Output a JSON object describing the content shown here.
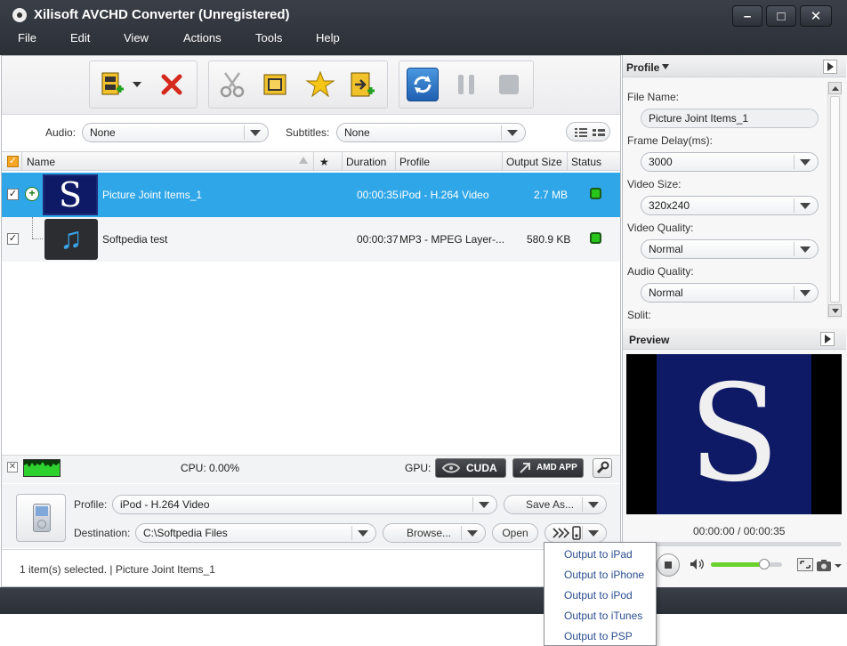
{
  "window": {
    "title": "Xilisoft AVCHD Converter (Unregistered)",
    "controls": {
      "minimize": "–",
      "maximize": "□",
      "close": "✕"
    }
  },
  "menu": [
    "File",
    "Edit",
    "View",
    "Actions",
    "Tools",
    "Help"
  ],
  "toolbar": {
    "icons": [
      "add-file-icon",
      "remove-icon",
      "clip-icon",
      "merge-icon",
      "effects-icon",
      "add-output-icon",
      "convert-icon",
      "pause-icon",
      "stop-icon"
    ]
  },
  "filters": {
    "audio_label": "Audio:",
    "audio_value": "None",
    "subtitles_label": "Subtitles:",
    "subtitles_value": "None"
  },
  "list": {
    "columns": {
      "name": "Name",
      "star": "★",
      "duration": "Duration",
      "profile": "Profile",
      "output_size": "Output Size",
      "status": "Status"
    },
    "rows": [
      {
        "name": "Picture Joint Items_1",
        "duration": "00:00:35",
        "profile": "iPod - H.264 Video",
        "output_size": "2.7 MB",
        "thumb_letter": "S",
        "selected": true
      },
      {
        "name": "Softpedia test",
        "duration": "00:00:37",
        "profile": "MP3 - MPEG Layer-...",
        "output_size": "580.9 KB",
        "thumb_letter": "♫",
        "selected": false
      }
    ]
  },
  "cpu": {
    "label": "CPU: 0.00%",
    "gpu_label": "GPU:",
    "cuda": "CUDA",
    "amd": "AMD APP"
  },
  "output": {
    "profile_label": "Profile:",
    "profile_value": "iPod - H.264 Video",
    "save_as": "Save As...",
    "destination_label": "Destination:",
    "destination_value": "C:\\Softpedia Files",
    "browse": "Browse...",
    "open": "Open"
  },
  "status_bar": {
    "text": "1 item(s) selected. | Picture Joint Items_1"
  },
  "profile_panel": {
    "header": "Profile",
    "file_name_label": "File Name:",
    "file_name_value": "Picture Joint Items_1",
    "frame_delay_label": "Frame Delay(ms):",
    "frame_delay_value": "3000",
    "video_size_label": "Video Size:",
    "video_size_value": "320x240",
    "video_quality_label": "Video Quality:",
    "video_quality_value": "Normal",
    "audio_quality_label": "Audio Quality:",
    "audio_quality_value": "Normal",
    "split_label": "Split:"
  },
  "preview": {
    "header": "Preview",
    "letter": "S",
    "time": "00:00:00 / 00:00:35",
    "volume_level": 0.75
  },
  "popup_menu": [
    "Output to iPad",
    "Output to iPhone",
    "Output to iPod",
    "Output to iTunes",
    "Output to PSP"
  ],
  "colors": {
    "selection": "#2fa6e8",
    "preview_bg": "#0f1a66",
    "status_green": "#27c41a"
  }
}
